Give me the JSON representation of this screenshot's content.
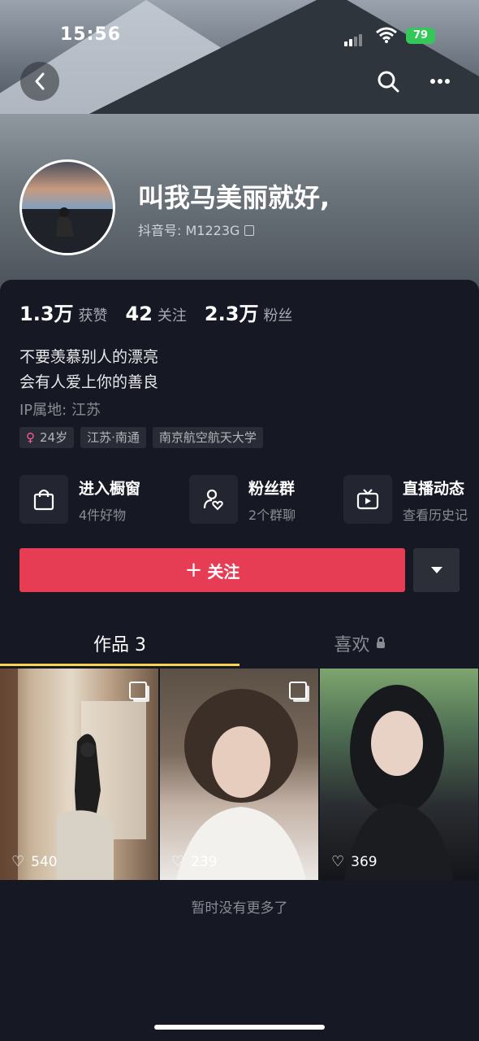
{
  "status_bar": {
    "time": "15:56",
    "battery": "79"
  },
  "profile": {
    "nickname": "叫我马美丽就好,",
    "douyin_id": "抖音号: M1223G",
    "stats": [
      {
        "value": "1.3万",
        "label": "获赞"
      },
      {
        "value": "42",
        "label": "关注"
      },
      {
        "value": "2.3万",
        "label": "粉丝"
      }
    ],
    "bio_lines": [
      "不要羡慕别人的漂亮",
      "会有人爱上你的善良"
    ],
    "ip": "IP属地: 江苏",
    "tags": [
      "24岁",
      "江苏·南通",
      "南京航空航天大学"
    ]
  },
  "actions": [
    {
      "title": "进入橱窗",
      "sub": "4件好物",
      "icon": "shopping-bag-icon"
    },
    {
      "title": "粉丝群",
      "sub": "2个群聊",
      "icon": "fan-group-icon"
    },
    {
      "title": "直播动态",
      "sub": "查看历史记",
      "icon": "tv-icon"
    }
  ],
  "follow_button": "关注",
  "tabs": {
    "works": "作品 3",
    "likes": "喜欢"
  },
  "videos": [
    {
      "likes": "540",
      "multi": true
    },
    {
      "likes": "239",
      "multi": true
    },
    {
      "likes": "369",
      "multi": false
    }
  ],
  "footer_text": "暂时没有更多了",
  "colors": {
    "background": "#161823",
    "follow": "#e63d55",
    "tab_underline": "#fcd34d",
    "battery": "#34c759"
  }
}
